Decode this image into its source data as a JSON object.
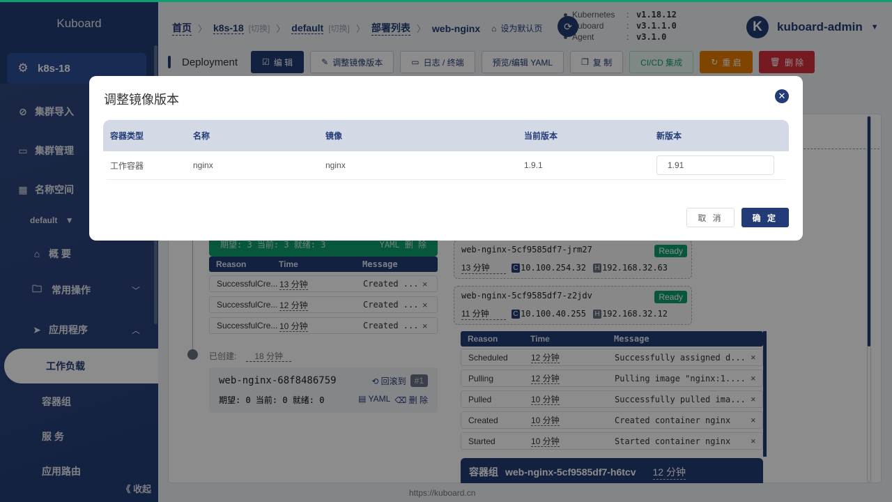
{
  "app": {
    "title": "Kuboard",
    "accent": "#233c77",
    "green": "#0e9f6e",
    "orange": "#e57c00",
    "red": "#d8303d"
  },
  "sidebar": {
    "cluster": "k8s-18",
    "items": [
      {
        "label": "集群导入",
        "icon": "link-icon"
      },
      {
        "label": "集群管理",
        "icon": "layers-icon"
      },
      {
        "label": "名称空间",
        "icon": "grid-icon"
      }
    ],
    "namespace": "default",
    "ns_items": [
      {
        "label": "概 要",
        "icon": "home-icon"
      },
      {
        "label": "常用操作",
        "icon": "folder-icon"
      },
      {
        "label": "应用程序",
        "icon": "send-icon"
      }
    ],
    "active": "工作负载",
    "sub_items": [
      "容器组",
      "服 务",
      "应用路由"
    ],
    "collapse": "《 收起"
  },
  "breadcrumb": {
    "home": "首页",
    "cluster": "k8s-18",
    "switch": "[切换]",
    "namespace": "default",
    "list": "部署列表",
    "current": "web-nginx",
    "set_default": "设为默认页"
  },
  "versions": [
    {
      "key": "Kubernetes",
      "value": "v1.18.12"
    },
    {
      "key": "Kuboard",
      "value": "v3.1.1.0"
    },
    {
      "key": "Agent",
      "value": "v3.1.0"
    }
  ],
  "user": {
    "avatar": "K",
    "name": "kuboard-admin"
  },
  "toolbar": {
    "kind": "Deployment",
    "edit": "编 辑",
    "adjust_image": "调整镜像版本",
    "logs": "日志 / 终端",
    "yaml": "预览/编辑 YAML",
    "copy": "复 制",
    "cicd": "CI/CD 集成",
    "restart": "重 启",
    "delete": "删 除"
  },
  "replicaset_current": {
    "stats": "期望: 3 当前: 3 就绪: 3",
    "yaml": "YAML",
    "delete": "删 除"
  },
  "rs_events": {
    "headers": [
      "Reason",
      "Time",
      "Message"
    ],
    "rows": [
      {
        "reason": "SuccessfulCre...",
        "time": "13 分钟",
        "message": "Created ..."
      },
      {
        "reason": "SuccessfulCre...",
        "time": "12 分钟",
        "message": "Created ..."
      },
      {
        "reason": "SuccessfulCre...",
        "time": "10 分钟",
        "message": "Created ..."
      }
    ]
  },
  "created": {
    "label": "已创建:",
    "time": "18 分钟"
  },
  "replicaset_old": {
    "name": "web-nginx-68f8486759",
    "rollback": "回滚到",
    "rev": "#1",
    "stats": "期望: 0 当前: 0 就绪: 0",
    "yaml": "YAML",
    "delete": "删 除"
  },
  "pods": [
    {
      "name": "web-nginx-5cf9585df7-jrm27",
      "status": "Ready",
      "age": "13 分钟",
      "cluster_ip": "10.100.254.32",
      "host_ip": "192.168.32.63"
    },
    {
      "name": "web-nginx-5cf9585df7-z2jdv",
      "status": "Ready",
      "age": "11 分钟",
      "cluster_ip": "10.100.40.255",
      "host_ip": "192.168.32.12"
    }
  ],
  "pod_events": {
    "headers": [
      "Reason",
      "Time",
      "Message"
    ],
    "rows": [
      {
        "reason": "Scheduled",
        "time": "12 分钟",
        "message": "Successfully assigned d..."
      },
      {
        "reason": "Pulling",
        "time": "12 分钟",
        "message": "Pulling image \"nginx:1...."
      },
      {
        "reason": "Pulled",
        "time": "10 分钟",
        "message": "Successfully pulled ima..."
      },
      {
        "reason": "Created",
        "time": "10 分钟",
        "message": "Created container nginx"
      },
      {
        "reason": "Started",
        "time": "10 分钟",
        "message": "Started container nginx"
      }
    ]
  },
  "pod_group": {
    "label": "容器组",
    "name": "web-nginx-5cf9585df7-h6tcv",
    "age": "12 分钟"
  },
  "footer": "https://kuboard.cn",
  "modal": {
    "title": "调整镜像版本",
    "headers": [
      "容器类型",
      "名称",
      "镜像",
      "当前版本",
      "新版本"
    ],
    "rows": [
      {
        "type": "工作容器",
        "name": "nginx",
        "image": "nginx",
        "current": "1.9.1",
        "new": "1.91"
      }
    ],
    "cancel": "取 消",
    "ok": "确 定"
  }
}
